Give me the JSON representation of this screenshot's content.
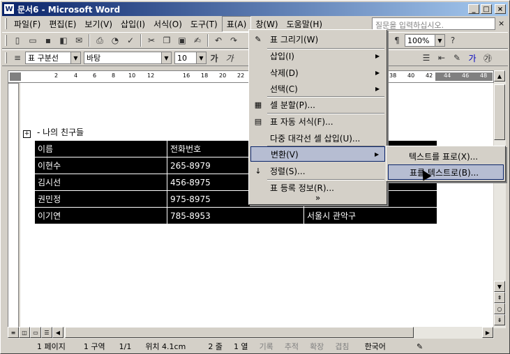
{
  "window": {
    "title": "문서6 - Microsoft Word",
    "app_icon": "W"
  },
  "menubar": {
    "items": [
      "파일(F)",
      "편집(E)",
      "보기(V)",
      "삽입(I)",
      "서식(O)",
      "도구(T)",
      "표(A)",
      "창(W)",
      "도움말(H)"
    ],
    "help_placeholder": "질문을 입력하십시오.",
    "help_close": "×"
  },
  "toolbar1": {
    "zoom": "100%"
  },
  "toolbar2": {
    "style": "표 구분선",
    "font": "바탕",
    "size": "10",
    "bold": "가",
    "italic": "가"
  },
  "ruler": {
    "numbers": [
      "2",
      "4",
      "6",
      "8",
      "10",
      "12",
      "16",
      "18",
      "20",
      "22",
      "38",
      "40",
      "42",
      "44",
      "46",
      "48"
    ]
  },
  "document": {
    "caption": "- 나의 친구들",
    "table": [
      [
        "이름",
        "전화번호",
        ""
      ],
      [
        "이현수",
        "265-8979",
        ""
      ],
      [
        "김시선",
        "456-8975",
        ""
      ],
      [
        "권민정",
        "975-8975",
        ""
      ],
      [
        "이기연",
        "785-8953",
        "서울시 관악구"
      ]
    ]
  },
  "table_menu": {
    "items": [
      {
        "label": "표 그리기(W)",
        "icon": "pencil-icon",
        "glyph": "✎"
      },
      {
        "label": "삽입(I)",
        "submenu": true
      },
      {
        "label": "삭제(D)",
        "submenu": true
      },
      {
        "label": "선택(C)",
        "submenu": true
      },
      {
        "label": "셀 분할(P)...",
        "icon": "split-cell-icon",
        "glyph": "▦"
      },
      {
        "label": "표 자동 서식(F)...",
        "icon": "autoformat-icon",
        "glyph": "▤"
      },
      {
        "label": "다중 대각선 셀 삽입(U)..."
      },
      {
        "label": "변환(V)",
        "submenu": true,
        "highlighted": true
      },
      {
        "label": "정렬(S)...",
        "icon": "sort-icon",
        "glyph": "↓"
      },
      {
        "label": "표 등록 정보(R)..."
      },
      {
        "label": "more",
        "expand": "»"
      }
    ]
  },
  "convert_submenu": {
    "items": [
      {
        "label": "텍스트를 표로(X)..."
      },
      {
        "label": "표를 텍스트로(B)...",
        "highlighted": true
      }
    ]
  },
  "statusbar": {
    "page": "1 페이지",
    "section": "1 구역",
    "pages": "1/1",
    "position": "위치 4.1cm",
    "line": "2 줄",
    "column": "1 열",
    "rec": "기록",
    "trk": "추적",
    "ext": "확장",
    "ovr": "겹침",
    "lang": "한국어"
  }
}
